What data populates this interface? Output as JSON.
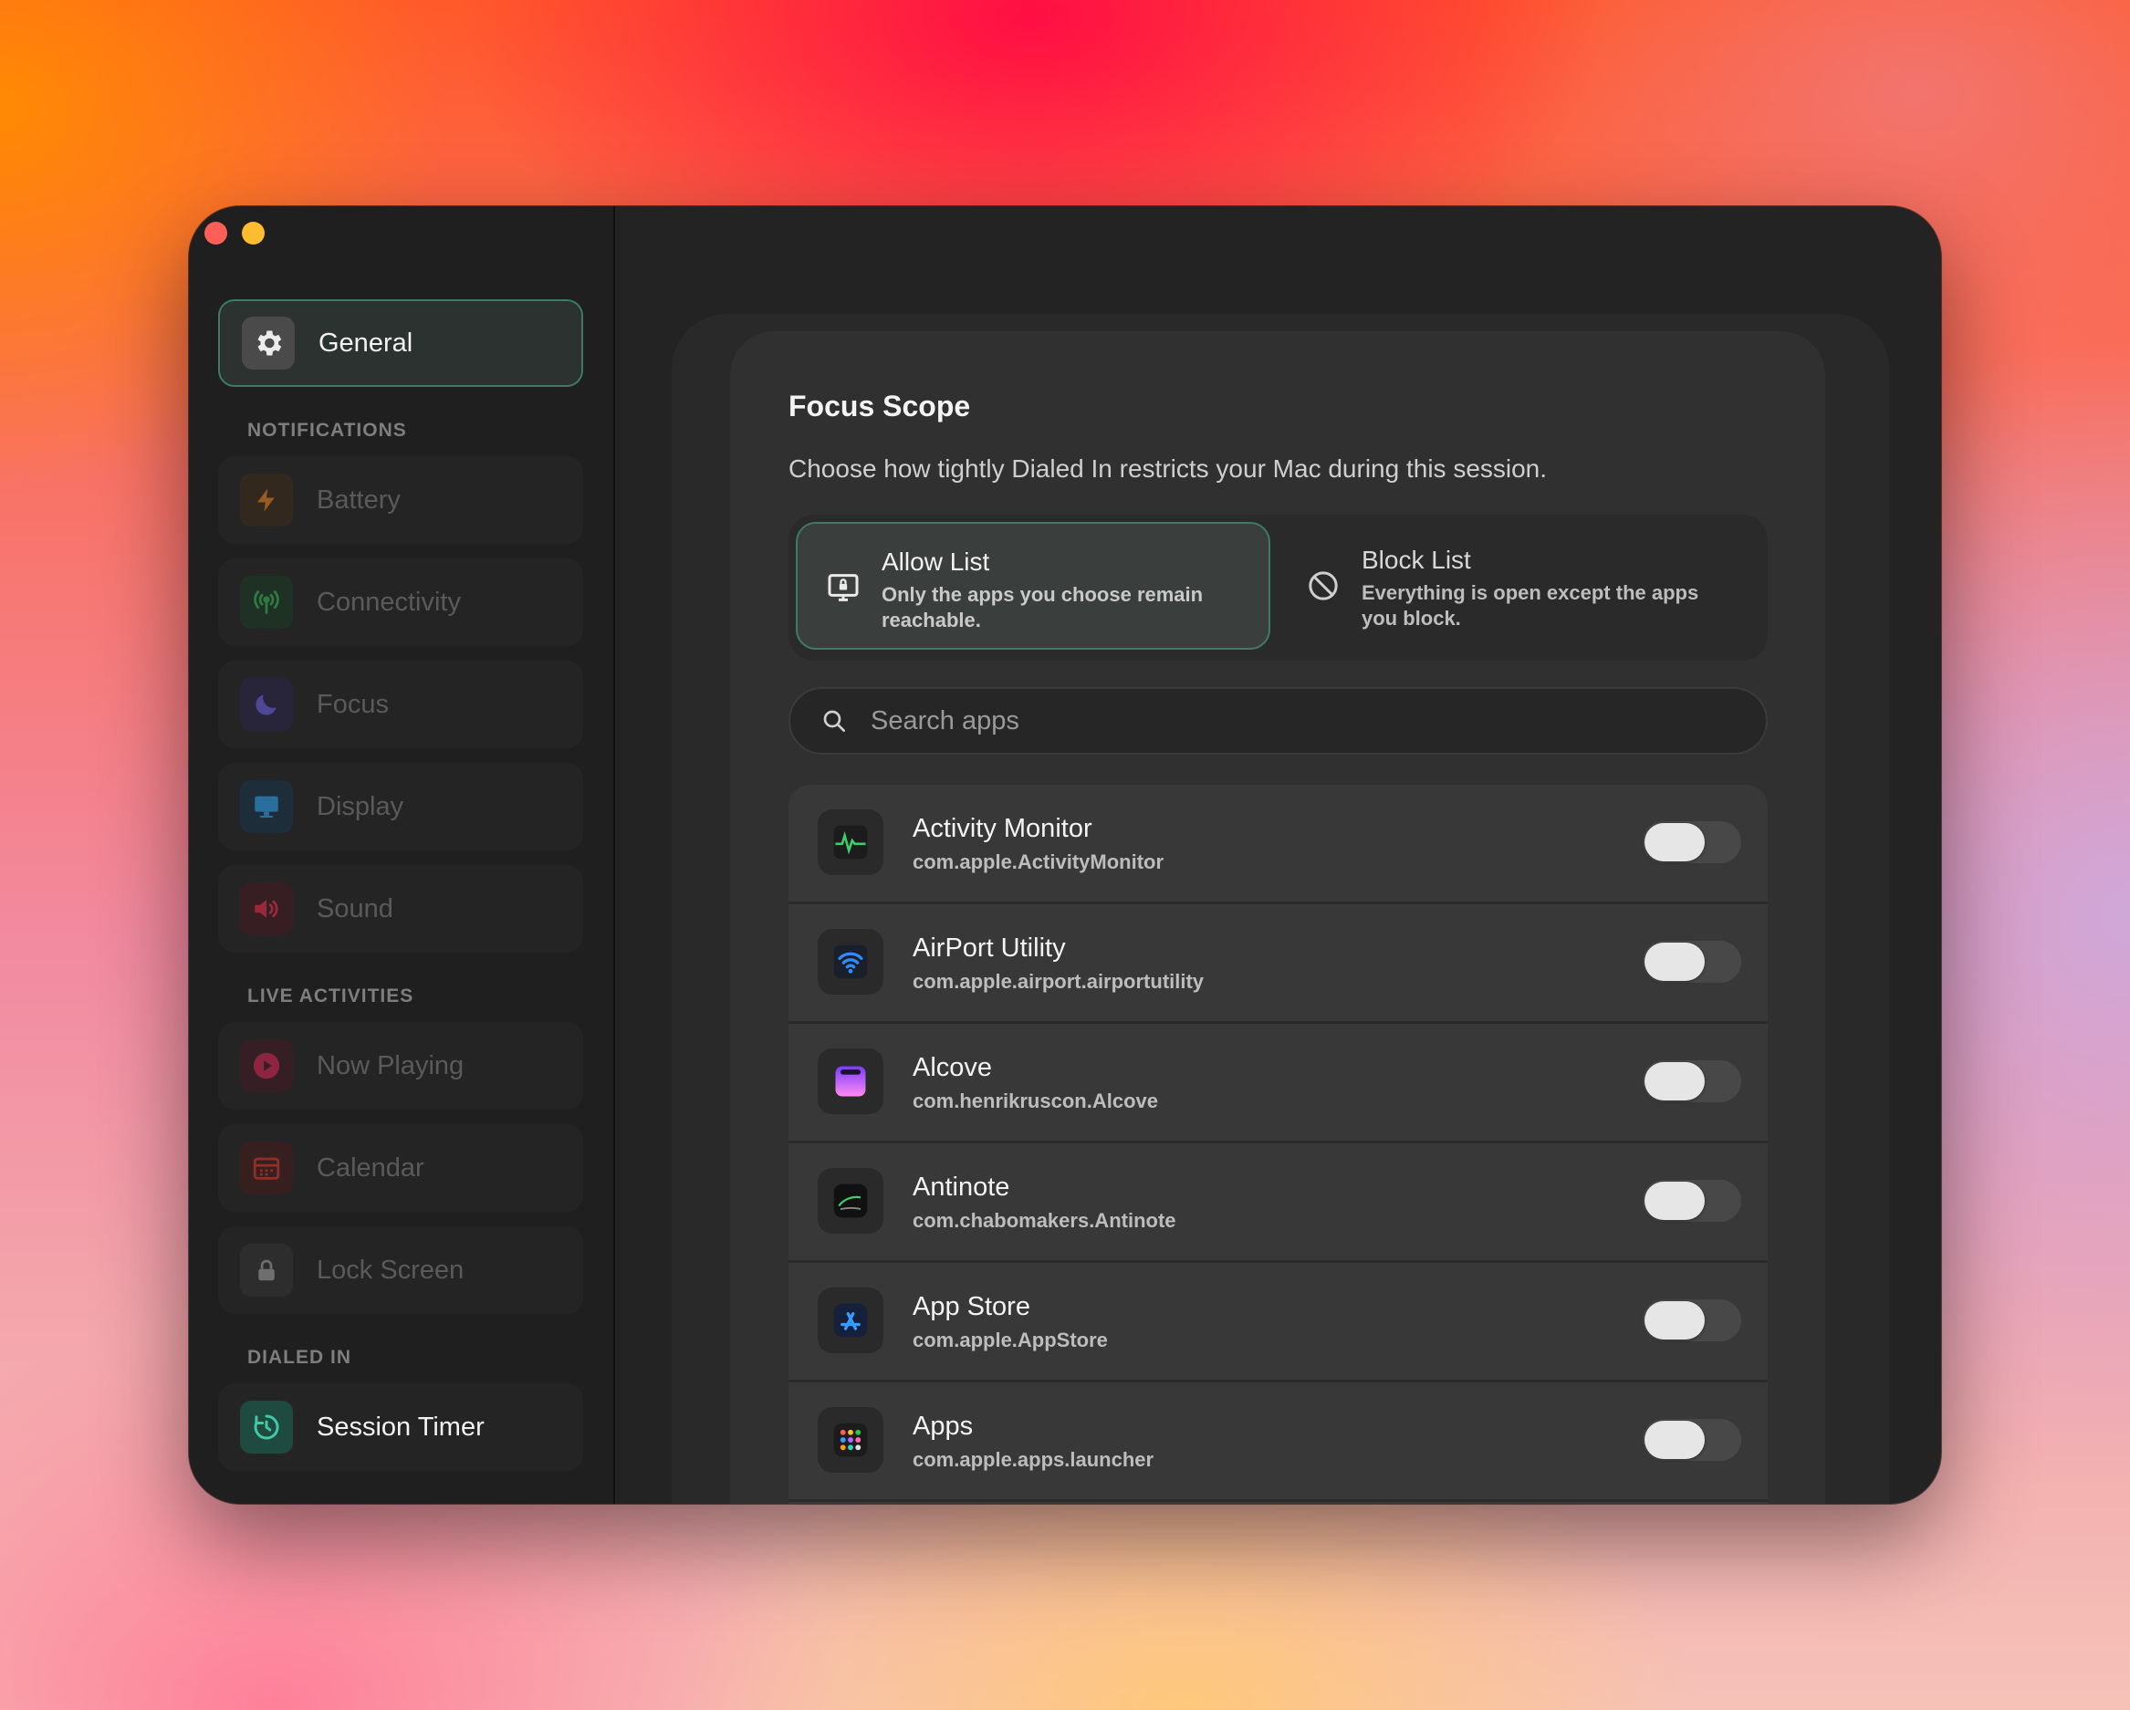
{
  "window": {
    "traffic_lights": [
      "close",
      "minimize"
    ]
  },
  "sidebar": {
    "general": {
      "label": "General",
      "icon": "gear-icon"
    },
    "sections": [
      {
        "title": "NOTIFICATIONS",
        "items": [
          {
            "label": "Battery",
            "icon": "bolt-icon",
            "color": "#e08a2c"
          },
          {
            "label": "Connectivity",
            "icon": "antenna-icon",
            "color": "#3fa85a"
          },
          {
            "label": "Focus",
            "icon": "moon-icon",
            "color": "#6b5fd0"
          },
          {
            "label": "Display",
            "icon": "monitor-icon",
            "color": "#3b9be0"
          },
          {
            "label": "Sound",
            "icon": "speaker-icon",
            "color": "#d8344a"
          }
        ]
      },
      {
        "title": "LIVE ACTIVITIES",
        "items": [
          {
            "label": "Now Playing",
            "icon": "play-icon",
            "color": "#e0345a"
          },
          {
            "label": "Calendar",
            "icon": "calendar-icon",
            "color": "#e0453a"
          },
          {
            "label": "Lock Screen",
            "icon": "lock-icon",
            "color": "#8a8a8a"
          }
        ]
      },
      {
        "title": "DIALED IN",
        "items": [
          {
            "label": "Session Timer",
            "icon": "timer-icon",
            "color": "#3fc9a8"
          }
        ]
      }
    ]
  },
  "focus_scope": {
    "title": "Focus Scope",
    "subtitle": "Choose how tightly Dialed In restricts your Mac during this session.",
    "options": [
      {
        "title": "Allow List",
        "description": "Only the apps you choose remain reachable.",
        "icon": "monitor-lock-icon",
        "selected": true
      },
      {
        "title": "Block List",
        "description": "Everything is open except the apps you block.",
        "icon": "prohibited-icon",
        "selected": false
      }
    ],
    "search": {
      "placeholder": "Search apps",
      "value": ""
    },
    "apps": [
      {
        "name": "Activity Monitor",
        "bundle": "com.apple.ActivityMonitor",
        "icon": "activity-monitor-icon",
        "enabled": false
      },
      {
        "name": "AirPort Utility",
        "bundle": "com.apple.airport.airportutility",
        "icon": "wifi-icon",
        "enabled": false
      },
      {
        "name": "Alcove",
        "bundle": "com.henrikruscon.Alcove",
        "icon": "alcove-icon",
        "enabled": false
      },
      {
        "name": "Antinote",
        "bundle": "com.chabomakers.Antinote",
        "icon": "antinote-icon",
        "enabled": false
      },
      {
        "name": "App Store",
        "bundle": "com.apple.AppStore",
        "icon": "app-store-icon",
        "enabled": false
      },
      {
        "name": "Apps",
        "bundle": "com.apple.apps.launcher",
        "icon": "apps-grid-icon",
        "enabled": false
      }
    ]
  },
  "colors": {
    "accent_border": "#3f7a67",
    "window_bg": "#232323",
    "sidebar_bg": "#1f1f1f",
    "card_bg": "#303030",
    "list_bg": "#383838"
  }
}
